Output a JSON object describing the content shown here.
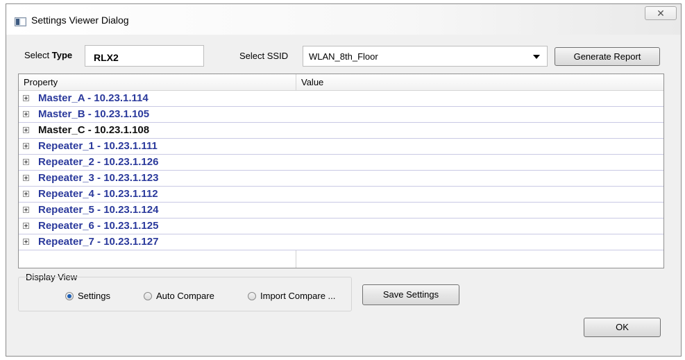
{
  "window": {
    "title": "Settings Viewer Dialog",
    "close_glyph": "✕",
    "app_icon": "window-app-icon",
    "close_icon": "close-icon"
  },
  "controls": {
    "select_label": "Select",
    "type_label": "Type",
    "type_value": "RLX2",
    "ssid_label": "Select SSID",
    "ssid_value": "WLAN_8th_Floor",
    "generate_label": "Generate Report"
  },
  "tree": {
    "columns": [
      "Property",
      "Value"
    ],
    "rows": [
      {
        "label": "Master_A - 10.23.1.114",
        "selected": false
      },
      {
        "label": "Master_B - 10.23.1.105",
        "selected": false
      },
      {
        "label": "Master_C - 10.23.1.108",
        "selected": true
      },
      {
        "label": "Repeater_1 - 10.23.1.111",
        "selected": false
      },
      {
        "label": "Repeater_2 - 10.23.1.126",
        "selected": false
      },
      {
        "label": "Repeater_3 - 10.23.1.123",
        "selected": false
      },
      {
        "label": "Repeater_4 - 10.23.1.112",
        "selected": false
      },
      {
        "label": "Repeater_5 - 10.23.1.124",
        "selected": false
      },
      {
        "label": "Repeater_6 - 10.23.1.125",
        "selected": false
      },
      {
        "label": "Repeater_7 - 10.23.1.127",
        "selected": false
      }
    ],
    "selected_color": "#111111",
    "text_color": "#2b3a9c"
  },
  "display_view": {
    "title": "Display View",
    "options": [
      "Settings",
      "Auto Compare",
      "Import Compare ..."
    ],
    "selected": "Settings"
  },
  "buttons": {
    "save": "Save Settings",
    "ok": "OK"
  }
}
